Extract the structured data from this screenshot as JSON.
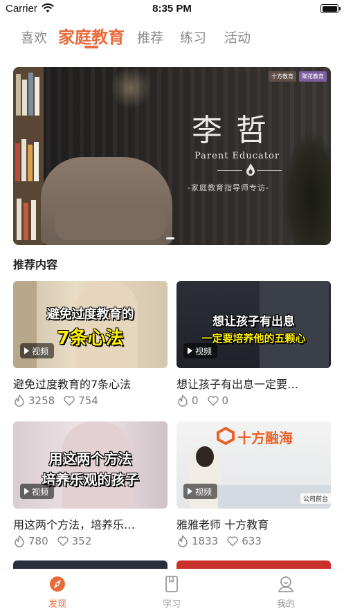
{
  "status_bar": {
    "carrier": "Carrier",
    "time": "8:35 PM"
  },
  "top_tabs": [
    {
      "label": "喜欢",
      "active": false
    },
    {
      "label": "家庭教育",
      "active": true
    },
    {
      "label": "推荐",
      "active": false
    },
    {
      "label": "练习",
      "active": false
    },
    {
      "label": "活动",
      "active": false
    }
  ],
  "banner": {
    "logo_left": "十方教育",
    "logo_right": "聚花教育",
    "name": "李哲",
    "subtitle_en": "Parent Educator",
    "subtitle_cn": "-家庭教育指导师专访-"
  },
  "section": {
    "title": "推荐内容"
  },
  "video_badge_label": "视频",
  "cards": [
    {
      "thumb_line1": "避免过度教育的",
      "thumb_line2": "7条心法",
      "title": "避免过度教育的7条心法",
      "likes": "3258",
      "favorites": "754"
    },
    {
      "thumb_line1": "想让孩子有出息",
      "thumb_line2": "一定要培养他的五颗心",
      "title": "想让孩子有出息一定要…",
      "likes": "0",
      "favorites": "0"
    },
    {
      "thumb_line1": "用这两个方法",
      "thumb_line2": "培养乐观的孩子",
      "title": "用这两个方法，培养乐…",
      "likes": "780",
      "favorites": "352"
    },
    {
      "thumb_line1": "十方融海",
      "thumb_line2": "公司前台",
      "title": "雅雅老师 十方教育",
      "likes": "1833",
      "favorites": "633"
    }
  ],
  "colors": {
    "accent": "#e86a3a",
    "muted": "#999999"
  },
  "bottom_nav": [
    {
      "label": "发现",
      "icon": "discover-compass-icon",
      "active": true
    },
    {
      "label": "学习",
      "icon": "book-icon",
      "active": false
    },
    {
      "label": "我的",
      "icon": "profile-icon",
      "active": false
    }
  ]
}
